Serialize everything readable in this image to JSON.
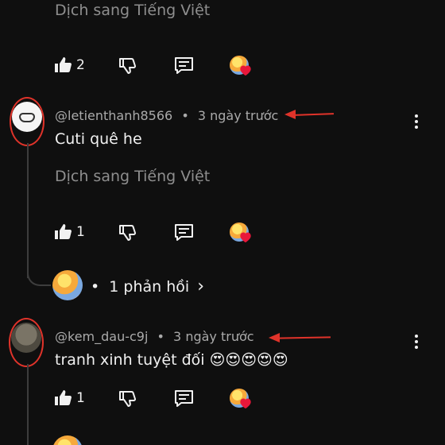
{
  "colors": {
    "background": "#0f0f0f",
    "text": "#f1f1f1",
    "muted": "#aaaaaa",
    "annotation": "#e0332a",
    "heart": "#e8173a"
  },
  "top_comment": {
    "translate_label": "Dịch sang Tiếng Việt",
    "like_count": "2"
  },
  "comments": [
    {
      "handle": "@letienthanh8566",
      "separator": "•",
      "time": "3 ngày trước",
      "text": "Cuti quê he",
      "translate_label": "Dịch sang Tiếng Việt",
      "like_count": "1",
      "replies": {
        "separator": "•",
        "label": "1 phản hồi",
        "chevron": "›"
      }
    },
    {
      "handle": "@kem_dau-c9j",
      "separator": "•",
      "time": "3 ngày trước",
      "text": "tranh xinh tuyệt đối 😍😍😍😍😍",
      "like_count": "1"
    }
  ],
  "icons": [
    "thumb-up-icon",
    "thumb-down-icon",
    "reply-icon",
    "creator-heart-icon",
    "more-vert-icon",
    "chevron-right-icon"
  ]
}
